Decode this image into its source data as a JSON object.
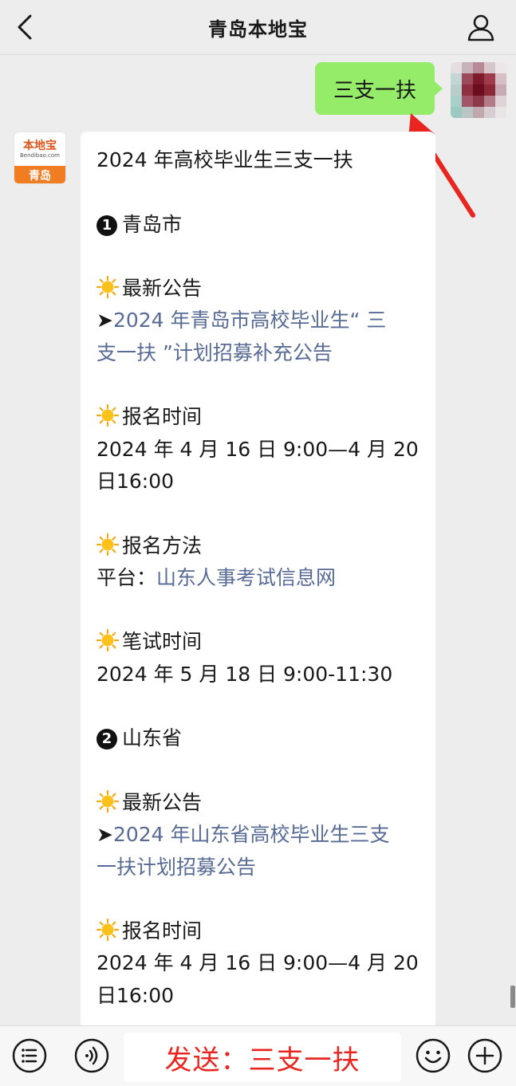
{
  "header": {
    "title": "青岛本地宝",
    "back_icon": "chevron-left-icon",
    "profile_icon": "person-icon"
  },
  "sent_message": {
    "text": "三支一扶"
  },
  "brand_avatar": {
    "name": "本地宝",
    "url": "Bendibao.com",
    "city": "青岛"
  },
  "reply": {
    "heading": "2024 年高校毕业生三支一扶",
    "sections": [
      {
        "number": "1",
        "region": "青岛市",
        "notice_label": "最新公告",
        "notice_link_line1": "2024 年青岛市高校毕业生“ 三",
        "notice_link_line2": "支一扶 ”计划招募补充公告",
        "signup_time_label": "报名时间",
        "signup_time_line1": "2024 年 4 月 16 日 9:00—4 月 20",
        "signup_time_line2": "日16:00",
        "signup_method_label": "报名方法",
        "platform_prefix": "平台：",
        "platform_link": "山东人事考试信息网",
        "exam_time_label": "笔试时间",
        "exam_time": "2024 年 5 月 18 日 9:00-11:30"
      },
      {
        "number": "2",
        "region": "山东省",
        "notice_label": "最新公告",
        "notice_link_line1": "2024 年山东省高校毕业生三支",
        "notice_link_line2": "一扶计划招募公告",
        "signup_time_label": "报名时间",
        "signup_time_line1": "2024 年 4 月 16 日 9:00—4 月 20",
        "signup_time_line2": "日16:00"
      }
    ],
    "link_arrow": "➤"
  },
  "bottom_bar": {
    "input_text": "发送：三支一扶",
    "menu_icon": "menu-list-icon",
    "voice_icon": "voice-icon",
    "emoji_icon": "emoji-icon",
    "plus_icon": "plus-icon"
  },
  "colors": {
    "background": "#ededed",
    "sent_bubble": "#95ec69",
    "link": "#576b95",
    "input_text": "#e8261f",
    "arrow": "#e8261f",
    "brand_orange": "#f07d22"
  }
}
